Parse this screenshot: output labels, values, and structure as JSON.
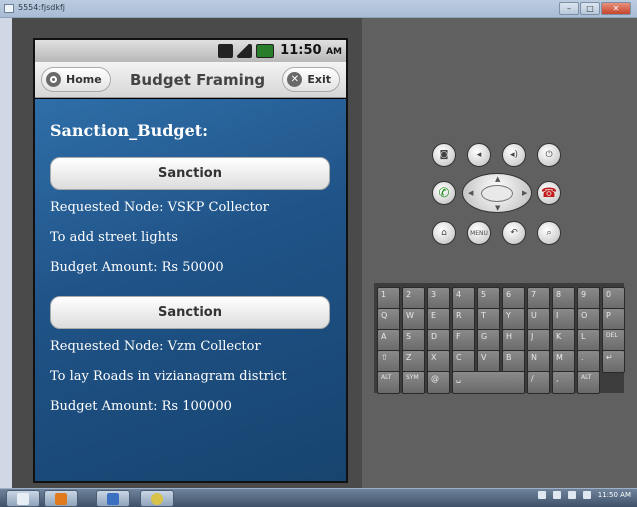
{
  "window": {
    "title": "5554:fjsdkfj"
  },
  "phone": {
    "status_time": "11:50",
    "status_ampm": "AM",
    "header": {
      "home_label": "Home",
      "title": "Budget Framing",
      "exit_label": "Exit"
    },
    "section_title": "Sanction_Budget:",
    "requests": [
      {
        "button_label": "Sanction",
        "node": "Requested Node: VSKP Collector",
        "purpose": "To add street lights",
        "amount": "Budget Amount: Rs 50000"
      },
      {
        "button_label": "Sanction",
        "node": "Requested Node: Vzm Collector",
        "purpose": "To lay Roads in vizianagram district",
        "amount": "Budget Amount: Rs 100000"
      }
    ]
  },
  "emulator_controls": {
    "row1": [
      "camera-icon",
      "volume-down-icon",
      "volume-up-icon",
      "power-icon"
    ],
    "row2": [
      "call-icon",
      "dpad",
      "end-call-icon"
    ],
    "row3": [
      "home-icon",
      "menu-icon",
      "back-icon",
      "search-icon"
    ],
    "menu_label": "MENU"
  },
  "keyboard": {
    "rows": [
      [
        "1",
        "2",
        "3",
        "4",
        "5",
        "6",
        "7",
        "8",
        "9",
        "0"
      ],
      [
        "Q",
        "W",
        "E",
        "R",
        "T",
        "Y",
        "U",
        "I",
        "O",
        "P"
      ],
      [
        "A",
        "S",
        "D",
        "F",
        "G",
        "H",
        "J",
        "K",
        "L",
        "DEL"
      ],
      [
        "⇧",
        "Z",
        "X",
        "C",
        "V",
        "B",
        "N",
        "M",
        ".",
        "↵"
      ],
      [
        "ALT",
        "SYM",
        "@",
        "␣",
        "/",
        ",",
        "ALT"
      ]
    ]
  },
  "taskbar": {
    "clock": "11:50 AM"
  },
  "colors": {
    "content_bg": "#1f5286",
    "accent_green": "#1a8d1a",
    "accent_red": "#c21a1a"
  }
}
